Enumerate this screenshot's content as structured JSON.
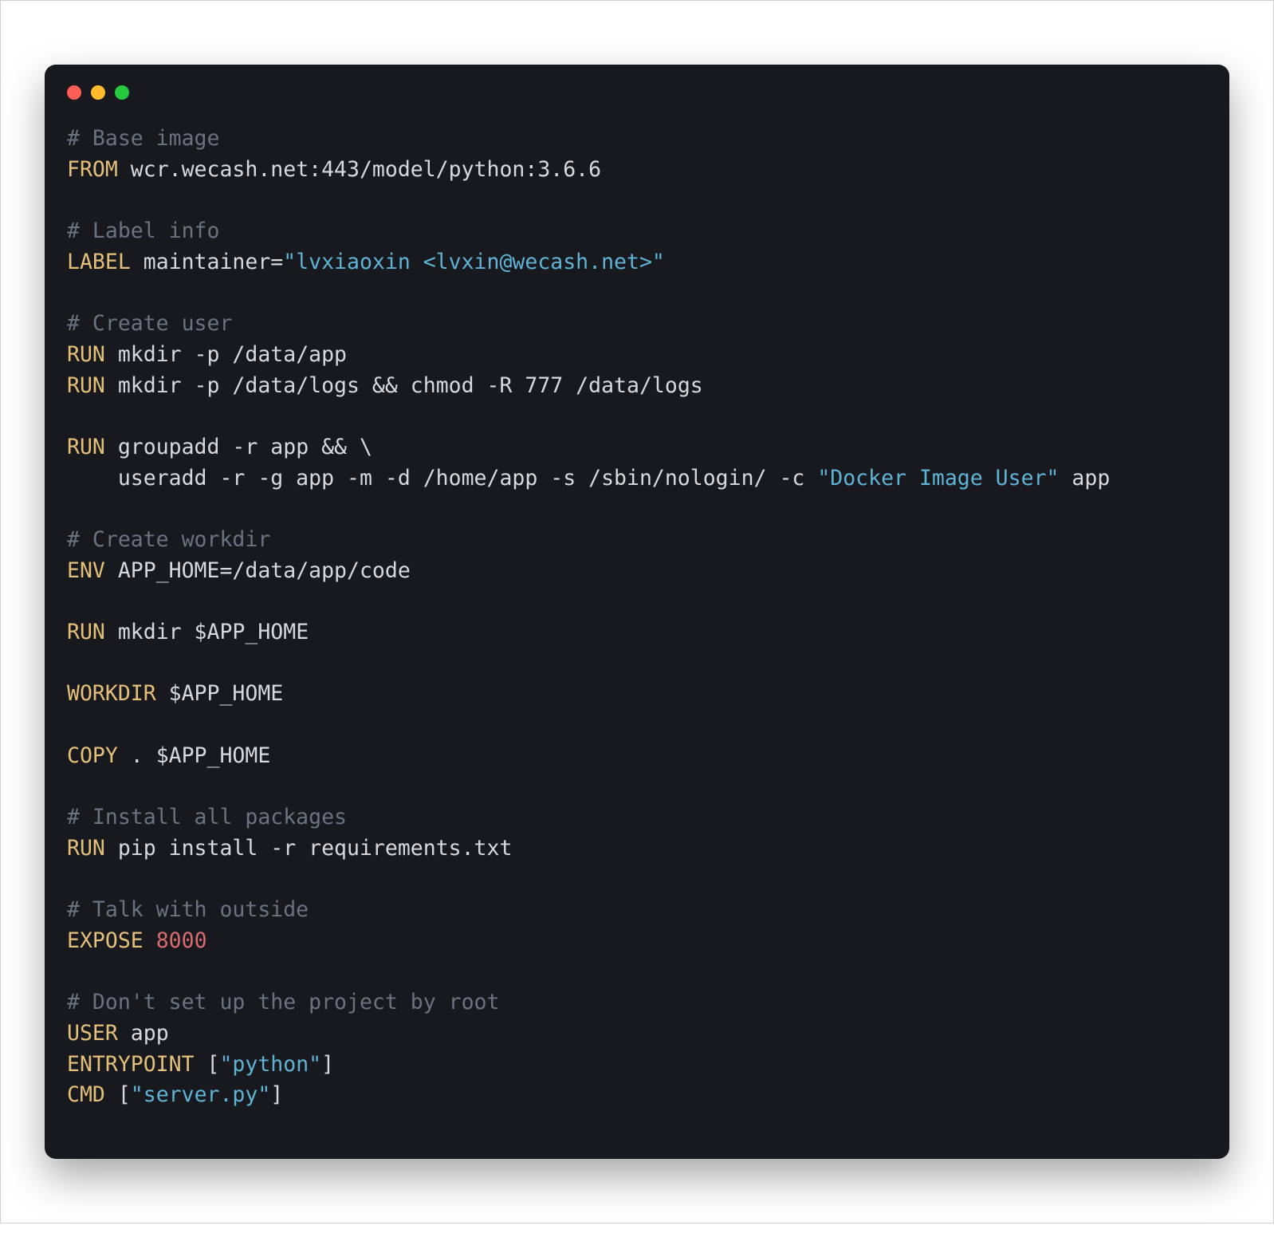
{
  "colors": {
    "background": "#17191f",
    "comment": "#6b7381",
    "keyword": "#e4c07a",
    "string": "#5fb3d4",
    "number": "#d96c6c",
    "plain": "#d6d9de",
    "traffic_red": "#ff5f56",
    "traffic_yellow": "#ffbd2e",
    "traffic_green": "#27c93f"
  },
  "code_tokens": [
    [
      {
        "c": "comment",
        "t": "# Base image"
      }
    ],
    [
      {
        "c": "keyword",
        "t": "FROM"
      },
      {
        "c": "plain",
        "t": " wcr.wecash.net:443/model/python:3.6.6"
      }
    ],
    [],
    [
      {
        "c": "comment",
        "t": "# Label info"
      }
    ],
    [
      {
        "c": "keyword",
        "t": "LABEL"
      },
      {
        "c": "plain",
        "t": " maintainer="
      },
      {
        "c": "string",
        "t": "\"lvxiaoxin <lvxin@wecash.net>\""
      }
    ],
    [],
    [
      {
        "c": "comment",
        "t": "# Create user"
      }
    ],
    [
      {
        "c": "keyword",
        "t": "RUN"
      },
      {
        "c": "plain",
        "t": " mkdir -p /data/app"
      }
    ],
    [
      {
        "c": "keyword",
        "t": "RUN"
      },
      {
        "c": "plain",
        "t": " mkdir -p /data/logs && chmod -R 777 /data/logs"
      }
    ],
    [],
    [
      {
        "c": "keyword",
        "t": "RUN"
      },
      {
        "c": "plain",
        "t": " groupadd -r app && \\"
      }
    ],
    [
      {
        "c": "plain",
        "t": "    useradd -r -g app -m -d /home/app -s /sbin/nologin/ -c "
      },
      {
        "c": "string",
        "t": "\"Docker Image User\""
      },
      {
        "c": "plain",
        "t": " app"
      }
    ],
    [],
    [
      {
        "c": "comment",
        "t": "# Create workdir"
      }
    ],
    [
      {
        "c": "keyword",
        "t": "ENV"
      },
      {
        "c": "plain",
        "t": " APP_HOME=/data/app/code"
      }
    ],
    [],
    [
      {
        "c": "keyword",
        "t": "RUN"
      },
      {
        "c": "plain",
        "t": " mkdir $APP_HOME"
      }
    ],
    [],
    [
      {
        "c": "keyword",
        "t": "WORKDIR"
      },
      {
        "c": "plain",
        "t": " $APP_HOME"
      }
    ],
    [],
    [
      {
        "c": "keyword",
        "t": "COPY"
      },
      {
        "c": "plain",
        "t": " . $APP_HOME"
      }
    ],
    [],
    [
      {
        "c": "comment",
        "t": "# Install all packages"
      }
    ],
    [
      {
        "c": "keyword",
        "t": "RUN"
      },
      {
        "c": "plain",
        "t": " pip install -r requirements.txt"
      }
    ],
    [],
    [
      {
        "c": "comment",
        "t": "# Talk with outside"
      }
    ],
    [
      {
        "c": "keyword",
        "t": "EXPOSE"
      },
      {
        "c": "plain",
        "t": " "
      },
      {
        "c": "number",
        "t": "8000"
      }
    ],
    [],
    [
      {
        "c": "comment",
        "t": "# Don't set up the project by root"
      }
    ],
    [
      {
        "c": "keyword",
        "t": "USER"
      },
      {
        "c": "plain",
        "t": " app"
      }
    ],
    [
      {
        "c": "keyword",
        "t": "ENTRYPOINT"
      },
      {
        "c": "plain",
        "t": " ["
      },
      {
        "c": "string",
        "t": "\"python\""
      },
      {
        "c": "plain",
        "t": "]"
      }
    ],
    [
      {
        "c": "keyword",
        "t": "CMD"
      },
      {
        "c": "plain",
        "t": " ["
      },
      {
        "c": "string",
        "t": "\"server.py\""
      },
      {
        "c": "plain",
        "t": "]"
      }
    ]
  ]
}
